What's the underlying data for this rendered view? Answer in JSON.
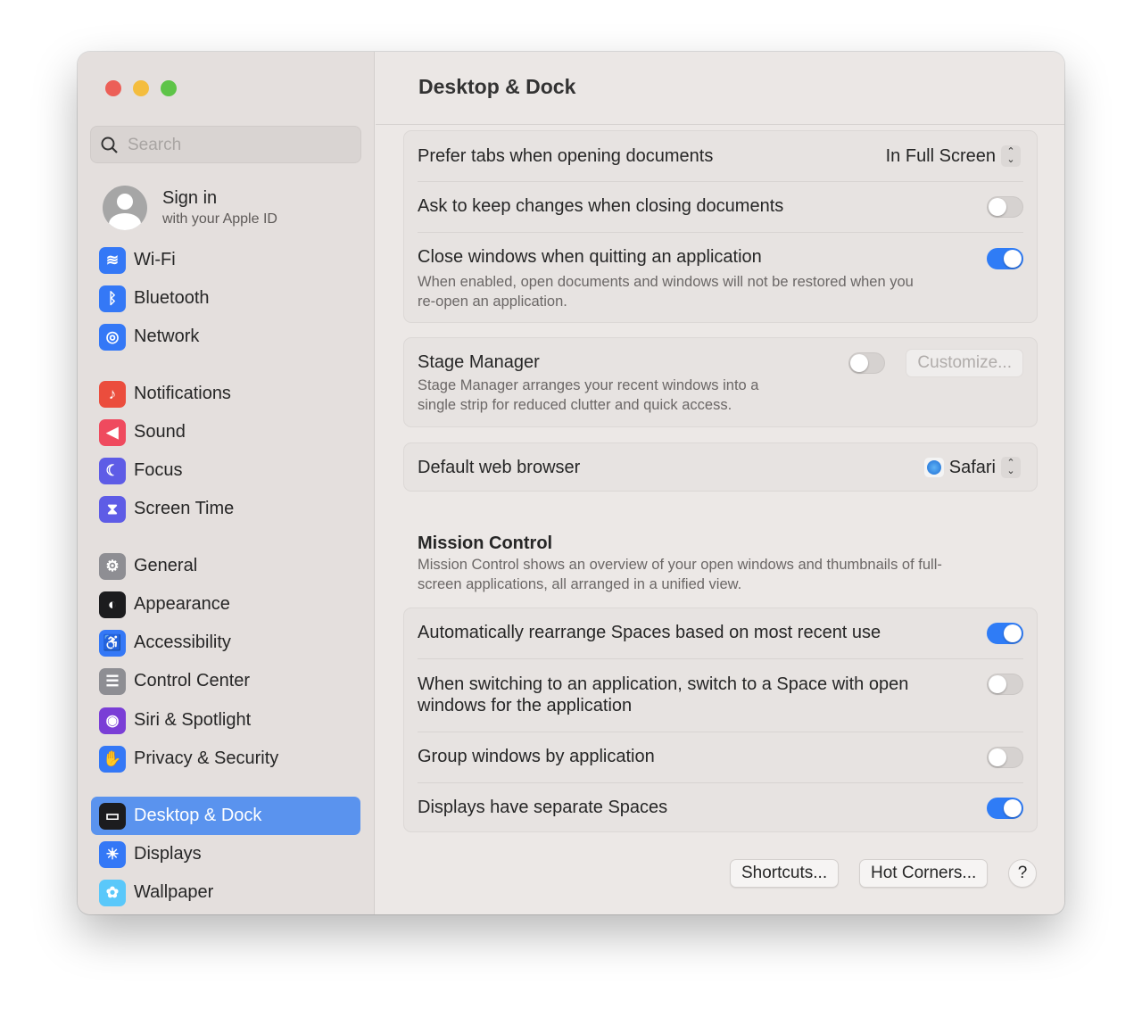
{
  "window": {
    "title": "Desktop & Dock"
  },
  "sidebar": {
    "search_placeholder": "Search",
    "account": {
      "title": "Sign in",
      "subtitle": "with your Apple ID"
    },
    "items": [
      {
        "label": "Wi-Fi",
        "icon": "wifi-icon",
        "color": "#3478f6"
      },
      {
        "label": "Bluetooth",
        "icon": "bluetooth-icon",
        "color": "#3478f6"
      },
      {
        "label": "Network",
        "icon": "globe-icon",
        "color": "#3478f6"
      },
      {
        "label": "Notifications",
        "icon": "bell-icon",
        "color": "#eb4d3d"
      },
      {
        "label": "Sound",
        "icon": "speaker-icon",
        "color": "#ef4a5e"
      },
      {
        "label": "Focus",
        "icon": "moon-icon",
        "color": "#5e5ce6"
      },
      {
        "label": "Screen Time",
        "icon": "hourglass-icon",
        "color": "#5e5ce6"
      },
      {
        "label": "General",
        "icon": "gear-icon",
        "color": "#8e8e93"
      },
      {
        "label": "Appearance",
        "icon": "appearance-icon",
        "color": "#1c1c1e"
      },
      {
        "label": "Accessibility",
        "icon": "accessibility-icon",
        "color": "#3478f6"
      },
      {
        "label": "Control Center",
        "icon": "control-center-icon",
        "color": "#8e8e93"
      },
      {
        "label": "Siri & Spotlight",
        "icon": "siri-icon",
        "color": "#7a3ed6"
      },
      {
        "label": "Privacy & Security",
        "icon": "hand-icon",
        "color": "#3478f6"
      },
      {
        "label": "Desktop & Dock",
        "icon": "dock-icon",
        "color": "#1c1c1e",
        "selected": true
      },
      {
        "label": "Displays",
        "icon": "sun-icon",
        "color": "#3478f6"
      },
      {
        "label": "Wallpaper",
        "icon": "flower-icon",
        "color": "#5ac8fa"
      }
    ]
  },
  "windows": {
    "prefer_tabs": {
      "label": "Prefer tabs when opening documents",
      "value": "In Full Screen"
    },
    "ask_keep": {
      "label": "Ask to keep changes when closing documents",
      "on": false
    },
    "close_windows": {
      "label": "Close windows when quitting an application",
      "desc1": "When enabled, open documents and windows will not be restored when you",
      "desc2": "re-open an application.",
      "on": true
    }
  },
  "stage_manager": {
    "label": "Stage Manager",
    "desc1": "Stage Manager arranges your recent windows into a",
    "desc2": "single strip for reduced clutter and quick access.",
    "on": false,
    "customize": "Customize..."
  },
  "browser": {
    "label": "Default web browser",
    "value": "Safari"
  },
  "mission_control": {
    "title": "Mission Control",
    "desc1": "Mission Control shows an overview of your open windows and thumbnails of full-",
    "desc2": "screen applications, all arranged in a unified view.",
    "rearrange": {
      "label": "Automatically rearrange Spaces based on most recent use",
      "on": true
    },
    "switch": {
      "label1": "When switching to an application, switch to a Space with open",
      "label2": "windows for the application",
      "on": false
    },
    "group": {
      "label": "Group windows by application",
      "on": false
    },
    "separate": {
      "label": "Displays have separate Spaces",
      "on": true
    }
  },
  "footer": {
    "shortcuts": "Shortcuts...",
    "hot_corners": "Hot Corners...",
    "help": "?"
  }
}
